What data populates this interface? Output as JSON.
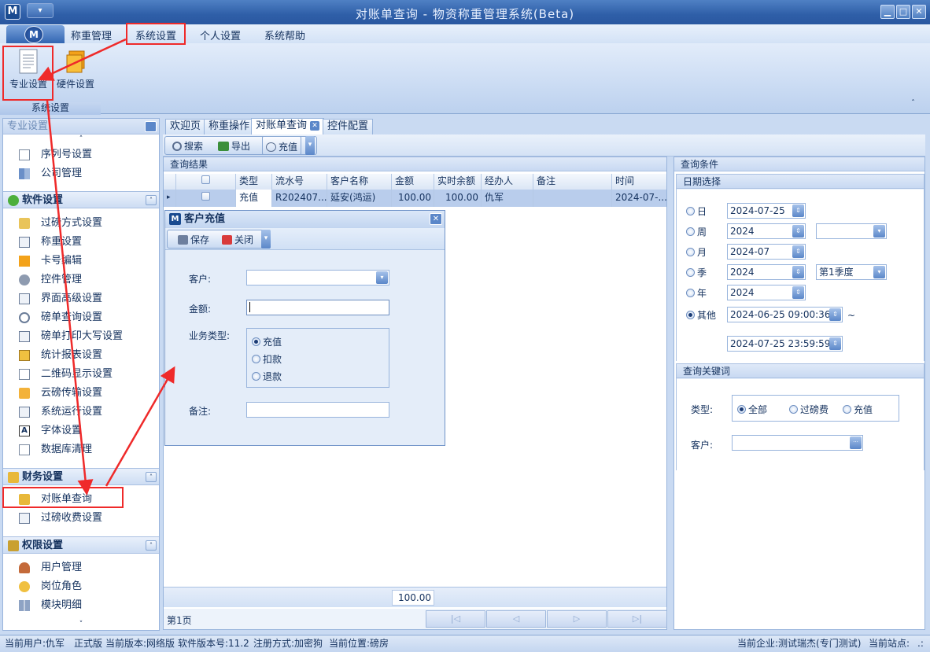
{
  "window": {
    "title": "对账单查询 - 物资称重管理系统(Beta)",
    "logo": "M",
    "qa_symbol": "▾",
    "min": "▁",
    "max": "□",
    "close": "✕"
  },
  "menu": {
    "orb": "M",
    "items": [
      "称重管理",
      "系统设置",
      "个人设置",
      "系统帮助"
    ]
  },
  "ribbon": {
    "buttons": [
      {
        "label": "专业设置",
        "icon": "document-icon"
      },
      {
        "label": "硬件设置",
        "icon": "folders-icon"
      }
    ],
    "group_label": "系统设置",
    "collapse": "ˆ"
  },
  "nav": {
    "header": "专业设置",
    "scroll_up": "˄",
    "scroll_down": "˅",
    "top_items": [
      "序列号设置",
      "公司管理"
    ],
    "software": {
      "title": "软件设置",
      "items": [
        "过磅方式设置",
        "称重设置",
        "卡号编辑",
        "控件管理",
        "界面高级设置",
        "磅单查询设置",
        "磅单打印大写设置",
        "统计报表设置",
        "二维码显示设置",
        "云磅传输设置",
        "系统运行设置",
        "字体设置",
        "数据库清理"
      ]
    },
    "finance": {
      "title": "财务设置",
      "items": [
        "对账单查询",
        "过磅收费设置"
      ]
    },
    "permission": {
      "title": "权限设置",
      "items": [
        "用户管理",
        "岗位角色",
        "模块明细"
      ]
    },
    "chevron": "˄"
  },
  "tabs": [
    {
      "label": "欢迎页"
    },
    {
      "label": "称重操作"
    },
    {
      "label": "对账单查询",
      "close": "✕"
    },
    {
      "label": "控件配置"
    }
  ],
  "toolbar": {
    "search": "搜索",
    "export": "导出",
    "recharge": "充值",
    "more": "▾"
  },
  "results": {
    "title": "查询结果",
    "columns": [
      "",
      "类型",
      "流水号",
      "客户名称",
      "金额",
      "实时余额",
      "经办人",
      "备注",
      "时间"
    ],
    "row": {
      "marker": "▸",
      "type": "充值",
      "serial": "R202407...",
      "customer": "延安(鸿运)",
      "amount": "100.00",
      "balance": "100.00",
      "operator": "仇军",
      "note": "",
      "time": "2024-07-..."
    },
    "total_amount": "100.00",
    "page": "第1页",
    "pager": [
      "|◁",
      "◁",
      "▷",
      "▷|"
    ]
  },
  "dialog": {
    "title": "客户充值",
    "icon": "M",
    "close": "✕",
    "save": "保存",
    "close_btn": "关闭",
    "more": "▾",
    "customer_label": "客户:",
    "amount_label": "金额:",
    "biz_label": "业务类型:",
    "note_label": "备注:",
    "biz_options": [
      "充值",
      "扣款",
      "退款"
    ],
    "biz_selected": "充值",
    "dd": "▾"
  },
  "query": {
    "title": "查询条件",
    "date_title": "日期选择",
    "rows": [
      {
        "label": "日",
        "value": "2024-07-25"
      },
      {
        "label": "周",
        "value": "2024",
        "extra": ""
      },
      {
        "label": "月",
        "value": "2024-07"
      },
      {
        "label": "季",
        "value": "2024",
        "extra": "第1季度"
      },
      {
        "label": "年",
        "value": "2024"
      },
      {
        "label": "其他",
        "value": "2024-06-25 09:00:36",
        "selected": true
      }
    ],
    "end": "2024-07-25 23:59:59",
    "tilde": "~",
    "spin": "⇕",
    "keyword_title": "查询关键词",
    "type_label": "类型:",
    "type_options": [
      "全部",
      "过磅费",
      "充值"
    ],
    "customer_label": "客户:",
    "ellipsis": "···"
  },
  "status": {
    "user": "当前用户:仇军",
    "edition": "正式版",
    "version": "当前版本:网络版",
    "software_version": "软件版本号:11.2",
    "reg": "注册方式:加密狗",
    "location": "当前位置:磅房",
    "company": "当前企业:测试瑞杰(专门测试)",
    "site": "当前站点:",
    "grip": ".:"
  },
  "colors": {
    "annotation": "#ef2a2a",
    "accent": "#2f5fa8"
  }
}
